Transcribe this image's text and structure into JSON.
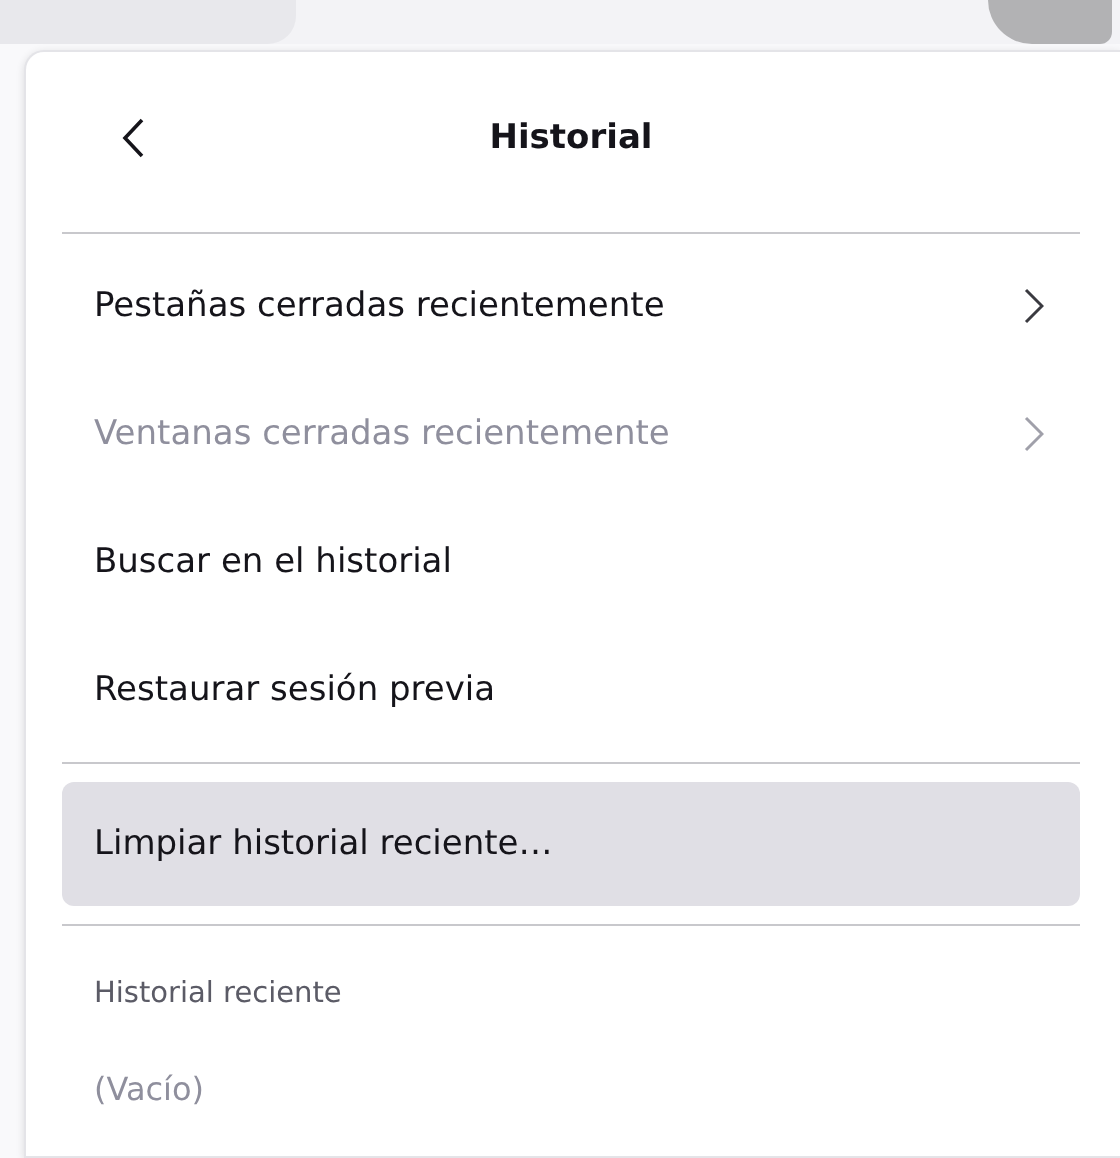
{
  "panel": {
    "title": "Historial"
  },
  "items": [
    {
      "label": "Pestañas cerradas recientemente",
      "kind": "submenu",
      "disabled": false,
      "selected": false
    },
    {
      "label": "Ventanas cerradas recientemente",
      "kind": "submenu",
      "disabled": true,
      "selected": false
    },
    {
      "label": "Buscar en el historial",
      "kind": "action",
      "disabled": false,
      "selected": false
    },
    {
      "label": "Restaurar sesión previa",
      "kind": "action",
      "disabled": false,
      "selected": false
    },
    {
      "kind": "separator"
    },
    {
      "label": "Limpiar historial reciente…",
      "kind": "action",
      "disabled": false,
      "selected": true
    },
    {
      "kind": "separator"
    }
  ],
  "recent": {
    "heading": "Historial reciente",
    "empty": "(Vacío)"
  }
}
